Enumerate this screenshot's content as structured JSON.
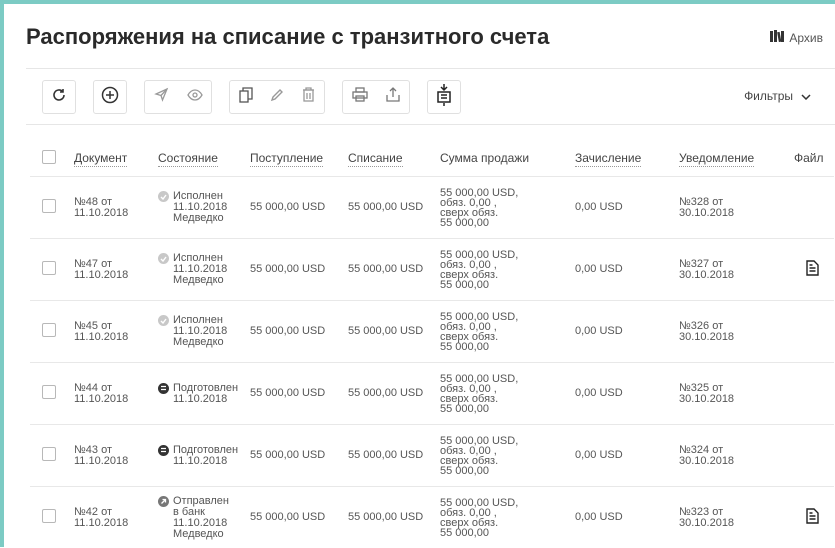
{
  "header": {
    "title": "Распоряжения на списание с транзитного счета",
    "archive_label": "Архив"
  },
  "toolbar": {
    "filters_label": "Фильтры"
  },
  "table": {
    "columns": [
      "Документ",
      "Состояние",
      "Поступление",
      "Списание",
      "Сумма продажи",
      "Зачисление",
      "Уведомление",
      "Файл"
    ],
    "rows": [
      {
        "doc": [
          "№48 от",
          "11.10.2018"
        ],
        "state_icon": "check-circle-icon",
        "state": [
          "Исполнен",
          "11.10.2018",
          "Медведко"
        ],
        "income": "55 000,00 USD",
        "writeoff": "55 000,00 USD",
        "sale": [
          "55 000,00 USD,",
          "обяз. 0,00 ,",
          "сверх обяз.",
          "55 000,00"
        ],
        "credit": "0,00 USD",
        "notice": [
          "№328 от",
          "30.10.2018"
        ],
        "file": false
      },
      {
        "doc": [
          "№47 от",
          "11.10.2018"
        ],
        "state_icon": "check-circle-icon",
        "state": [
          "Исполнен",
          "11.10.2018",
          "Медведко"
        ],
        "income": "55 000,00 USD",
        "writeoff": "55 000,00 USD",
        "sale": [
          "55 000,00 USD,",
          "обяз. 0,00 ,",
          "сверх обяз.",
          "55 000,00"
        ],
        "credit": "0,00 USD",
        "notice": [
          "№327 от",
          "30.10.2018"
        ],
        "file": true
      },
      {
        "doc": [
          "№45 от",
          "11.10.2018"
        ],
        "state_icon": "check-circle-icon",
        "state": [
          "Исполнен",
          "11.10.2018",
          "Медведко"
        ],
        "income": "55 000,00 USD",
        "writeoff": "55 000,00 USD",
        "sale": [
          "55 000,00 USD,",
          "обяз. 0,00 ,",
          "сверх обяз.",
          "55 000,00"
        ],
        "credit": "0,00 USD",
        "notice": [
          "№326 от",
          "30.10.2018"
        ],
        "file": false
      },
      {
        "doc": [
          "№44 от",
          "11.10.2018"
        ],
        "state_icon": "prepared-icon",
        "state": [
          "Подготовлен",
          "11.10.2018"
        ],
        "income": "55 000,00 USD",
        "writeoff": "55 000,00 USD",
        "sale": [
          "55 000,00 USD,",
          "обяз. 0,00 ,",
          "сверх обяз.",
          "55 000,00"
        ],
        "credit": "0,00 USD",
        "notice": [
          "№325 от",
          "30.10.2018"
        ],
        "file": false
      },
      {
        "doc": [
          "№43 от",
          "11.10.2018"
        ],
        "state_icon": "prepared-icon",
        "state": [
          "Подготовлен",
          "11.10.2018"
        ],
        "income": "55 000,00 USD",
        "writeoff": "55 000,00 USD",
        "sale": [
          "55 000,00 USD,",
          "обяз. 0,00 ,",
          "сверх обяз.",
          "55 000,00"
        ],
        "credit": "0,00 USD",
        "notice": [
          "№324 от",
          "30.10.2018"
        ],
        "file": false
      },
      {
        "doc": [
          "№42 от",
          "11.10.2018"
        ],
        "state_icon": "sent-icon",
        "state": [
          "Отправлен",
          "в банк",
          "11.10.2018",
          "Медведко"
        ],
        "income": "55 000,00 USD",
        "writeoff": "55 000,00 USD",
        "sale": [
          "55 000,00 USD,",
          "обяз. 0,00 ,",
          "сверх обяз.",
          "55 000,00"
        ],
        "credit": "0,00 USD",
        "notice": [
          "№323 от",
          "30.10.2018"
        ],
        "file": true
      }
    ]
  }
}
